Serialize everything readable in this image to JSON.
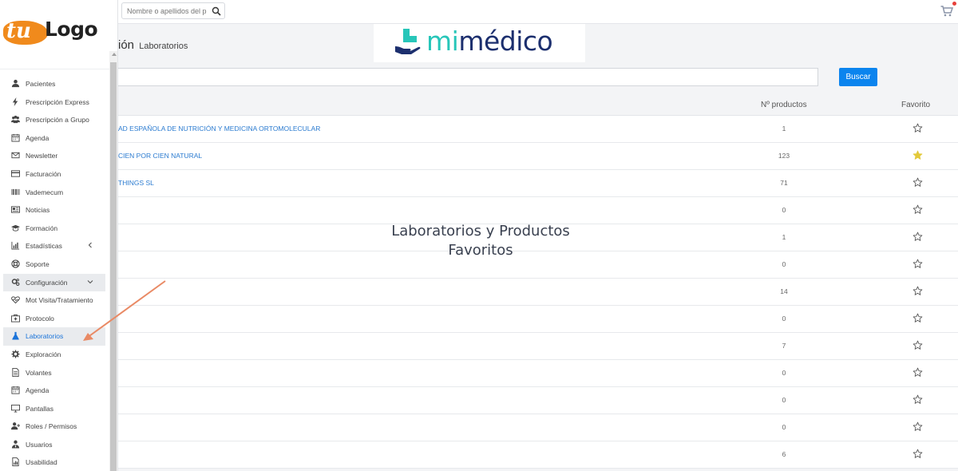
{
  "header": {
    "search_placeholder": "Nombre o apellidos del p",
    "icons": {
      "search": "search-icon",
      "cart": "cart-icon"
    }
  },
  "brand": {
    "logo_left": "tu",
    "logo_right": "Logo",
    "banner_mi": "mi",
    "banner_medico": "médico",
    "colors": {
      "mi": "#27c6b9",
      "medico": "#1c2f6e",
      "logo_orange": "#f08a1c"
    }
  },
  "page": {
    "title_fragment": "ión",
    "subtitle": "Laboratorios"
  },
  "filter": {
    "search_value": "",
    "button_label": "Buscar"
  },
  "table": {
    "headers": {
      "count": "Nº productos",
      "favorite": "Favorito"
    },
    "rows": [
      {
        "name": "AD ESPAÑOLA DE NUTRICIÓN Y MEDICINA ORTOMOLECULAR",
        "count": "1",
        "favorite": false
      },
      {
        "name": "CIEN POR CIEN NATURAL",
        "count": "123",
        "favorite": true
      },
      {
        "name": "THINGS SL",
        "count": "71",
        "favorite": false
      },
      {
        "name": "",
        "count": "0",
        "favorite": false
      },
      {
        "name": "",
        "count": "1",
        "favorite": false
      },
      {
        "name": "",
        "count": "0",
        "favorite": false
      },
      {
        "name": "",
        "count": "14",
        "favorite": false
      },
      {
        "name": "",
        "count": "0",
        "favorite": false
      },
      {
        "name": "",
        "count": "7",
        "favorite": false
      },
      {
        "name": "",
        "count": "0",
        "favorite": false
      },
      {
        "name": "",
        "count": "0",
        "favorite": false
      },
      {
        "name": "",
        "count": "0",
        "favorite": false
      },
      {
        "name": "",
        "count": "6",
        "favorite": false
      }
    ]
  },
  "caption": {
    "line1": "Laboratorios y Productos",
    "line2": "Favoritos"
  },
  "sidebar": {
    "items": [
      {
        "label": "Pacientes",
        "icon": "user-icon"
      },
      {
        "label": "Prescripción Express",
        "icon": "bolt-icon"
      },
      {
        "label": "Prescripción a Grupo",
        "icon": "users-icon"
      },
      {
        "label": "Agenda",
        "icon": "calendar-icon"
      },
      {
        "label": "Newsletter",
        "icon": "envelope-icon"
      },
      {
        "label": "Facturación",
        "icon": "credit-card-icon"
      },
      {
        "label": "Vademecum",
        "icon": "barcode-icon"
      },
      {
        "label": "Noticias",
        "icon": "newspaper-icon"
      },
      {
        "label": "Formación",
        "icon": "graduation-cap-icon"
      },
      {
        "label": "Estadísticas",
        "icon": "bar-chart-icon"
      },
      {
        "label": "Soporte",
        "icon": "life-ring-icon"
      },
      {
        "label": "Configuración",
        "icon": "cogs-icon"
      },
      {
        "label": "Mot Visita/Tratamiento",
        "icon": "heartbeat-icon"
      },
      {
        "label": "Protocolo",
        "icon": "medkit-icon"
      },
      {
        "label": "Laboratorios",
        "icon": "flask-icon"
      },
      {
        "label": "Exploración",
        "icon": "gear-icon"
      },
      {
        "label": "Volantes",
        "icon": "file-icon"
      },
      {
        "label": "Agenda",
        "icon": "calendar-icon"
      },
      {
        "label": "Pantallas",
        "icon": "monitor-icon"
      },
      {
        "label": "Roles / Permisos",
        "icon": "user-plus-icon"
      },
      {
        "label": "Usuarios",
        "icon": "user-tie-icon"
      },
      {
        "label": "Usabilidad",
        "icon": "file-chart-icon"
      }
    ],
    "selected_color": "#1a73d9"
  },
  "accent": {
    "primary": "#0b84ee",
    "star_filled": "#e3c93a",
    "arrow": "#e98a65"
  }
}
